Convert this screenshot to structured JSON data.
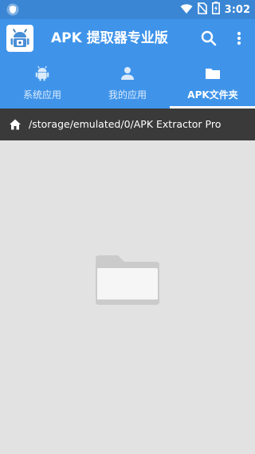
{
  "statusbar": {
    "time": "3:02",
    "icons": [
      "shield-icon",
      "wifi-icon",
      "no-sim-icon",
      "battery-charging-icon"
    ]
  },
  "appbar": {
    "title": "APK 提取器专业版",
    "icons": [
      "app-logo",
      "search-icon",
      "more-vert-icon"
    ]
  },
  "tabs": [
    {
      "label": "系统应用",
      "icon": "android-icon",
      "active": false
    },
    {
      "label": "我的应用",
      "icon": "person-icon",
      "active": false
    },
    {
      "label": "APK文件夹",
      "icon": "folder-icon",
      "active": true
    }
  ],
  "path": {
    "icon": "home-icon",
    "text": "/storage/emulated/0/APK Extractor Pro"
  },
  "content": {
    "empty_state_icon": "empty-folder-icon"
  },
  "colors": {
    "statusbar": "#3a86d4",
    "primary": "#3f94ea",
    "pathbar": "#3a3a3a",
    "background": "#e2e2e2"
  }
}
